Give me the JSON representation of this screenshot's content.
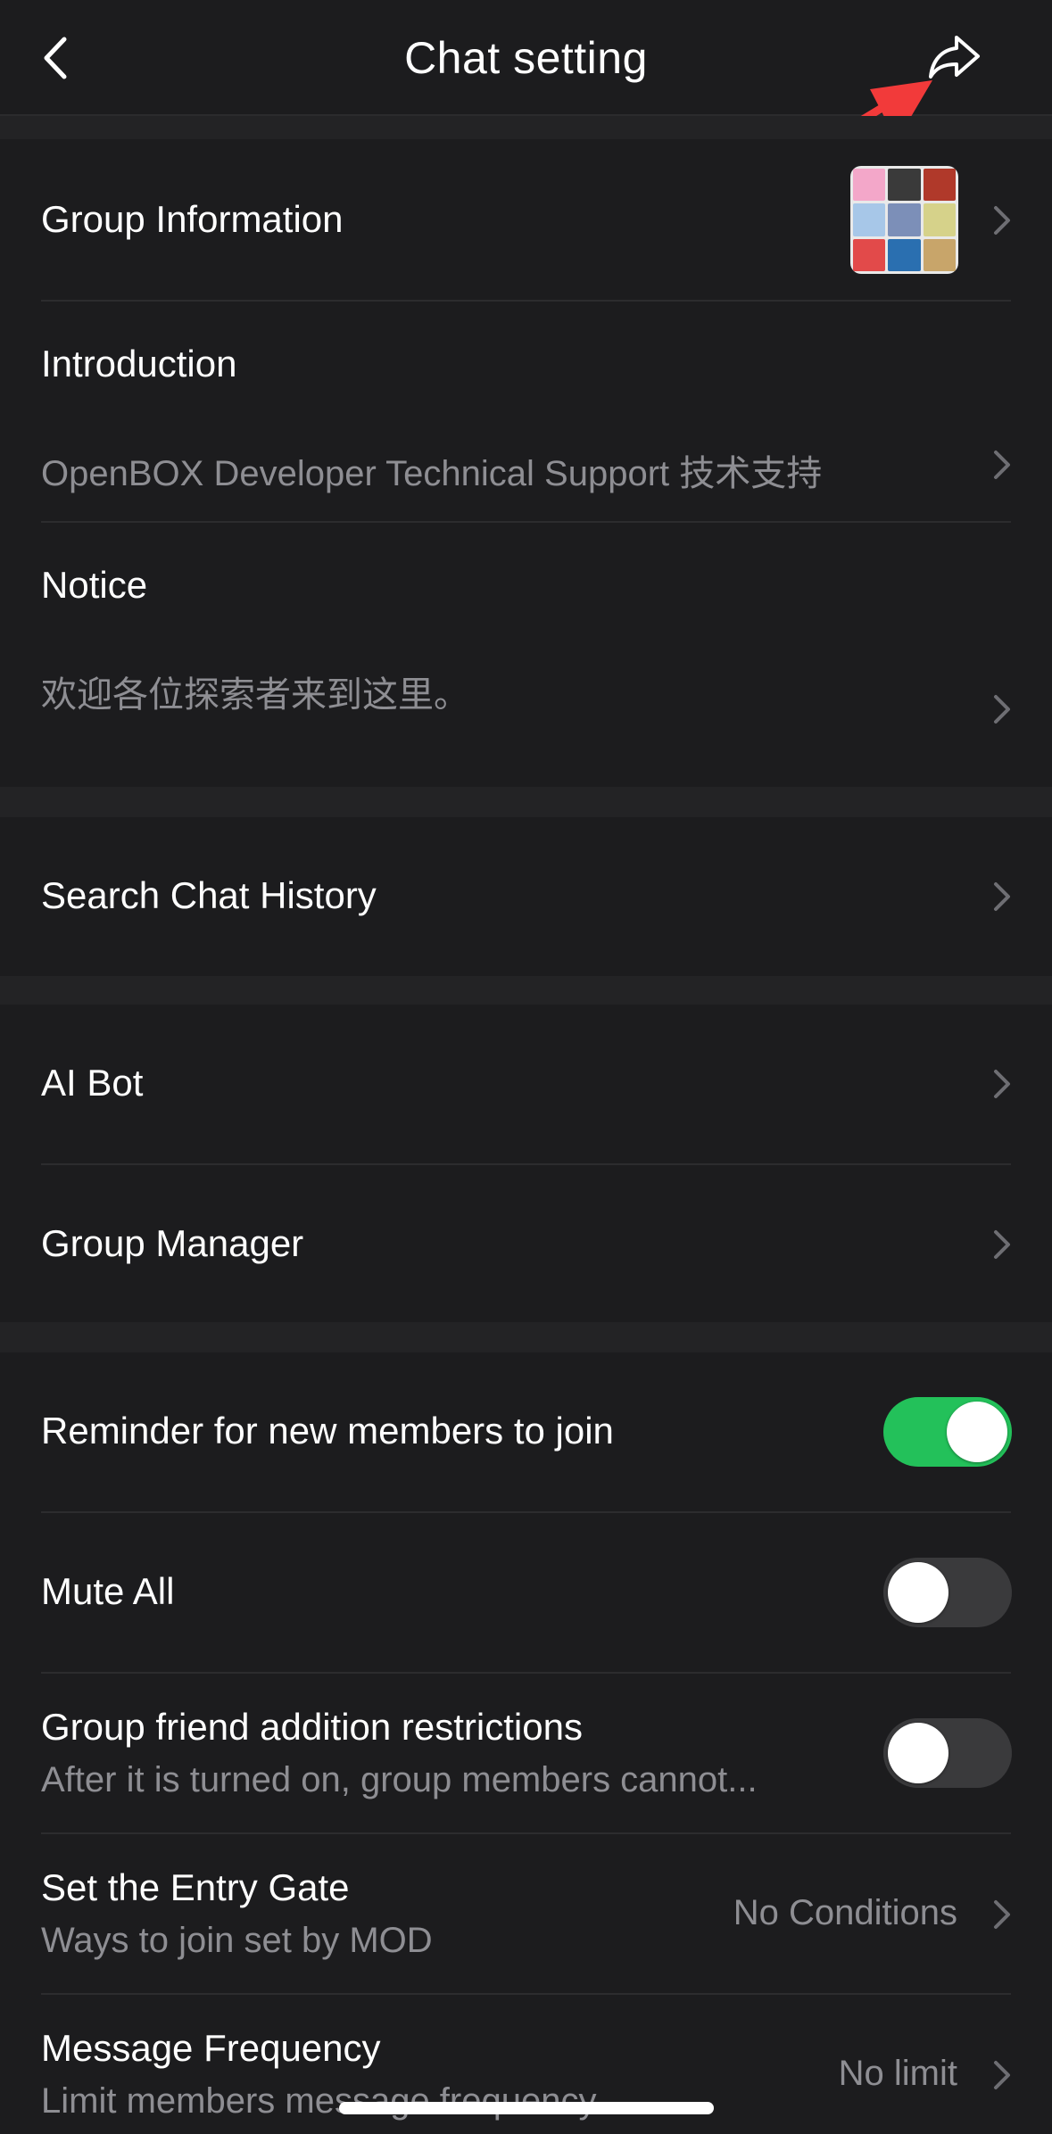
{
  "header": {
    "title": "Chat setting",
    "back_icon": "chevron-left-icon",
    "share_icon": "share-icon"
  },
  "group_info": {
    "label": "Group Information",
    "avatar_colors": [
      "#f3a7c9",
      "#3a3a3a",
      "#b0392a",
      "#a7c7e8",
      "#7c8fb8",
      "#d6d28a",
      "#e24a4a",
      "#2a6fb0",
      "#c8a56a"
    ]
  },
  "introduction": {
    "label": "Introduction",
    "text": "OpenBOX Developer Technical Support 技术支持"
  },
  "notice": {
    "label": "Notice",
    "text": "欢迎各位探索者来到这里。"
  },
  "search": {
    "label": "Search Chat History"
  },
  "ai_bot": {
    "label": "AI Bot"
  },
  "group_manager": {
    "label": "Group Manager"
  },
  "reminder": {
    "label": "Reminder for new members to join",
    "enabled": true
  },
  "mute_all": {
    "label": "Mute All",
    "enabled": false
  },
  "friend_restrictions": {
    "label": "Group friend addition restrictions",
    "sub": "After it is turned on, group members cannot...",
    "enabled": false
  },
  "entry_gate": {
    "label": "Set the Entry Gate",
    "sub": "Ways to join set by MOD",
    "value": "No Conditions"
  },
  "message_frequency": {
    "label": "Message Frequency",
    "sub": "Limit members message frequency",
    "value": "No limit"
  },
  "colors": {
    "background": "#1c1c1e",
    "section_gap": "#232325",
    "toggle_on": "#23c15a",
    "toggle_off": "#3a3a3c",
    "annotation_arrow": "#f23a3a"
  }
}
